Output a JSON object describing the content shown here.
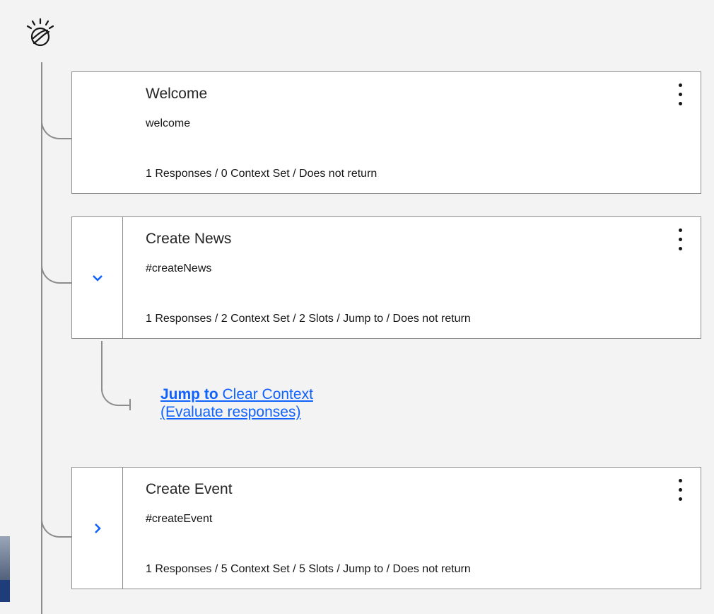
{
  "nodes": [
    {
      "title": "Welcome",
      "condition": "welcome",
      "summary": "1 Responses / 0 Context Set / Does not return",
      "toggle": null
    },
    {
      "title": "Create News",
      "condition": "#createNews",
      "summary": "1 Responses / 2 Context Set / 2 Slots / Jump to / Does not return",
      "toggle": "chevron-down-icon"
    },
    {
      "title": "Create Event",
      "condition": "#createEvent",
      "summary": "1 Responses / 5 Context Set / 5 Slots / Jump to / Does not return",
      "toggle": "chevron-right-icon"
    }
  ],
  "jump": {
    "bold_label": "Jump to",
    "target": "Clear Context",
    "mode": "(Evaluate responses)"
  },
  "colors": {
    "accent": "#0f62fe",
    "line": "#8d8d8d",
    "background": "#f3f3f3"
  }
}
